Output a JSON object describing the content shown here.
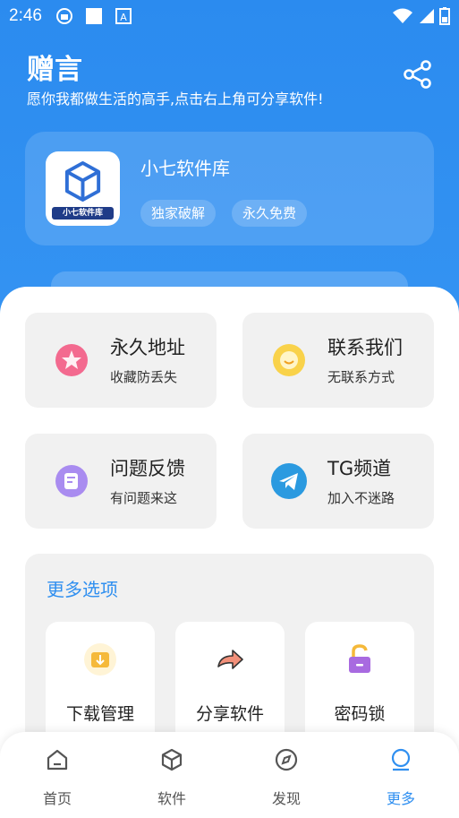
{
  "status": {
    "time": "2:46"
  },
  "header": {
    "title": "赠言",
    "subtitle": "愿你我都做生活的高手,点击右上角可分享软件!"
  },
  "profile": {
    "logo_text": "小七软件库",
    "name": "小七软件库",
    "tags": [
      "独家破解",
      "永久免费"
    ]
  },
  "quick_links": [
    {
      "title": "永久地址",
      "subtitle": "收藏防丢失",
      "icon": "star-icon"
    },
    {
      "title": "联系我们",
      "subtitle": "无联系方式",
      "icon": "chat-icon"
    },
    {
      "title": "问题反馈",
      "subtitle": "有问题来这",
      "icon": "feedback-icon"
    },
    {
      "title": "TG频道",
      "subtitle": "加入不迷路",
      "icon": "telegram-icon"
    }
  ],
  "more": {
    "title": "更多选项",
    "options": [
      {
        "label": "下载管理",
        "icon": "download-folder-icon"
      },
      {
        "label": "分享软件",
        "icon": "share-arrow-icon"
      },
      {
        "label": "密码锁",
        "icon": "lock-icon"
      }
    ]
  },
  "nav": [
    {
      "label": "首页",
      "icon": "home-icon"
    },
    {
      "label": "软件",
      "icon": "cube-icon"
    },
    {
      "label": "发现",
      "icon": "compass-icon"
    },
    {
      "label": "更多",
      "icon": "more-icon"
    }
  ],
  "colors": {
    "primary": "#2f8ff0",
    "card_bg": "#f1f1f1"
  }
}
